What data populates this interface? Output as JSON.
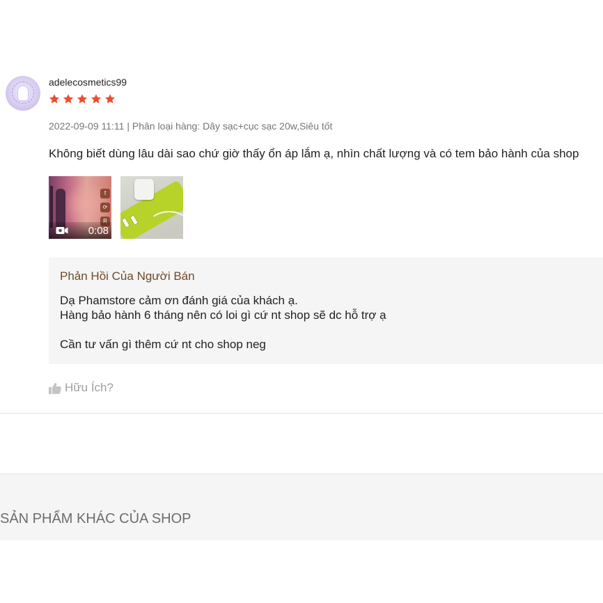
{
  "review": {
    "username": "adelecosmetics99",
    "rating": 5,
    "rating_max": 5,
    "star_color": "#ee4d2d",
    "meta": "2022-09-09 11:11 | Phân loại hàng: Dây sạc+cục sạc 20w,Siêu tốt",
    "comment": "Không biết dùng lâu dài sao chứ giờ thấy ổn áp lắm ạ, nhìn chất lượng và có tem bảo hành của shop",
    "media": {
      "video": {
        "duration": "0:08",
        "icon": "video-camera-icon"
      },
      "photo": {
        "icon": "image"
      }
    }
  },
  "seller_reply": {
    "title": "Phản Hồi Của Người Bán",
    "lines": [
      "Dạ Phamstore cảm ơn đánh giá của khách ạ.",
      "Hàng bảo hành 6 tháng nên có loi gì cứ nt shop sẽ dc hỗ trợ ạ",
      "",
      "Cần tư vấn gì thêm cứ nt cho shop neg"
    ]
  },
  "helpful": {
    "label": "Hữu Ích?",
    "icon": "thumbs-up-icon"
  },
  "other_products": {
    "title": "SẢN PHẨM KHÁC CỦA SHOP"
  }
}
